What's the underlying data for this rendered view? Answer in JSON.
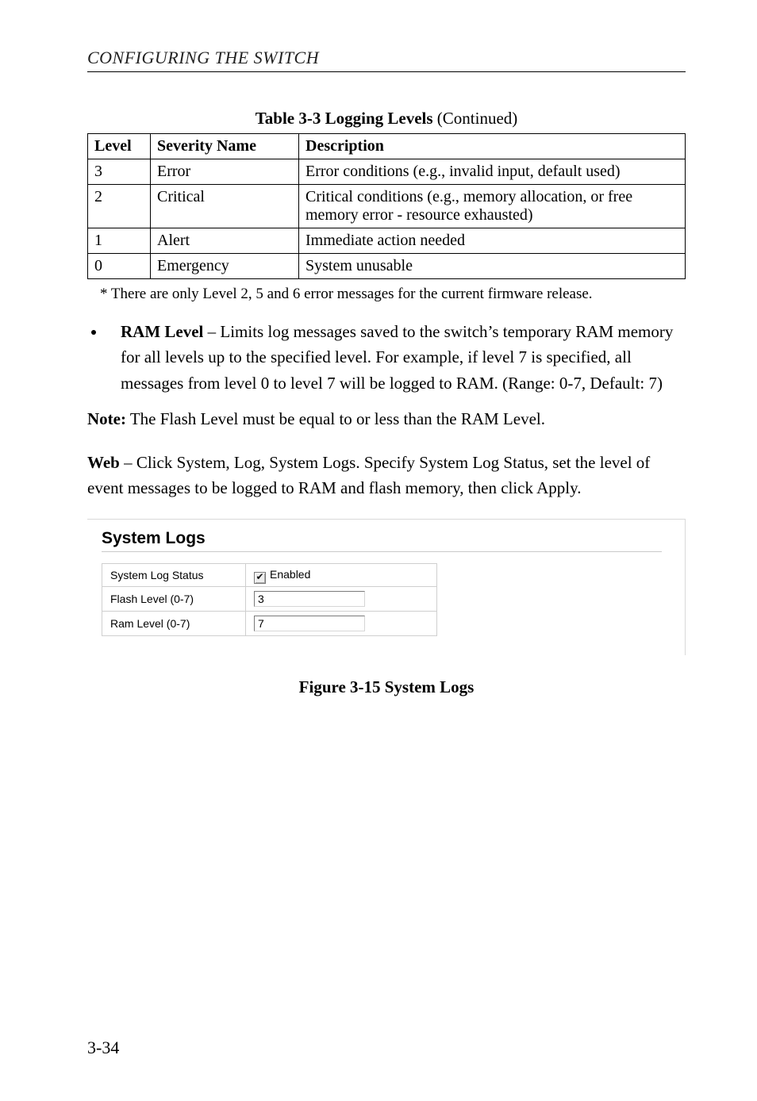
{
  "running_head": "CONFIGURING THE SWITCH",
  "table_caption_prefix": "Table 3-3  Logging Levels",
  "table_caption_suffix": " (Continued)",
  "table_headers": {
    "level": "Level",
    "name": "Severity Name",
    "desc": "Description"
  },
  "rows": [
    {
      "level": "3",
      "name": "Error",
      "desc": "Error conditions (e.g., invalid input, default used)"
    },
    {
      "level": "2",
      "name": "Critical",
      "desc": "Critical conditions (e.g., memory allocation, or free memory error - resource exhausted)"
    },
    {
      "level": "1",
      "name": "Alert",
      "desc": "Immediate action needed"
    },
    {
      "level": "0",
      "name": "Emergency",
      "desc": "System unusable"
    }
  ],
  "footnote": "* There are only Level 2, 5 and 6 error messages for the current firmware release.",
  "bullet": {
    "term": "RAM Level",
    "rest": " – Limits log messages saved to the switch’s temporary RAM memory for all levels up to the specified level. For example, if level 7 is specified, all messages from level 0 to level 7 will be logged to RAM. (Range: 0-7, Default: 7)"
  },
  "note_label": "Note:",
  "note_body": "  The Flash Level must be equal to or less than the RAM Level.",
  "web_label": "Web",
  "web_body": " – Click System, Log, System Logs. Specify System Log Status, set the level of event messages to be logged to RAM and flash memory, then click Apply.",
  "panel": {
    "title": "System Logs",
    "rows": {
      "status_label": "System Log Status",
      "status_checkbox_glyph": "✔",
      "status_enabled_label": "Enabled",
      "flash_label": "Flash Level (0-7)",
      "flash_value": "3",
      "ram_label": "Ram Level (0-7)",
      "ram_value": "7"
    }
  },
  "figure_caption": "Figure 3-15  System Logs",
  "page_number": "3-34"
}
